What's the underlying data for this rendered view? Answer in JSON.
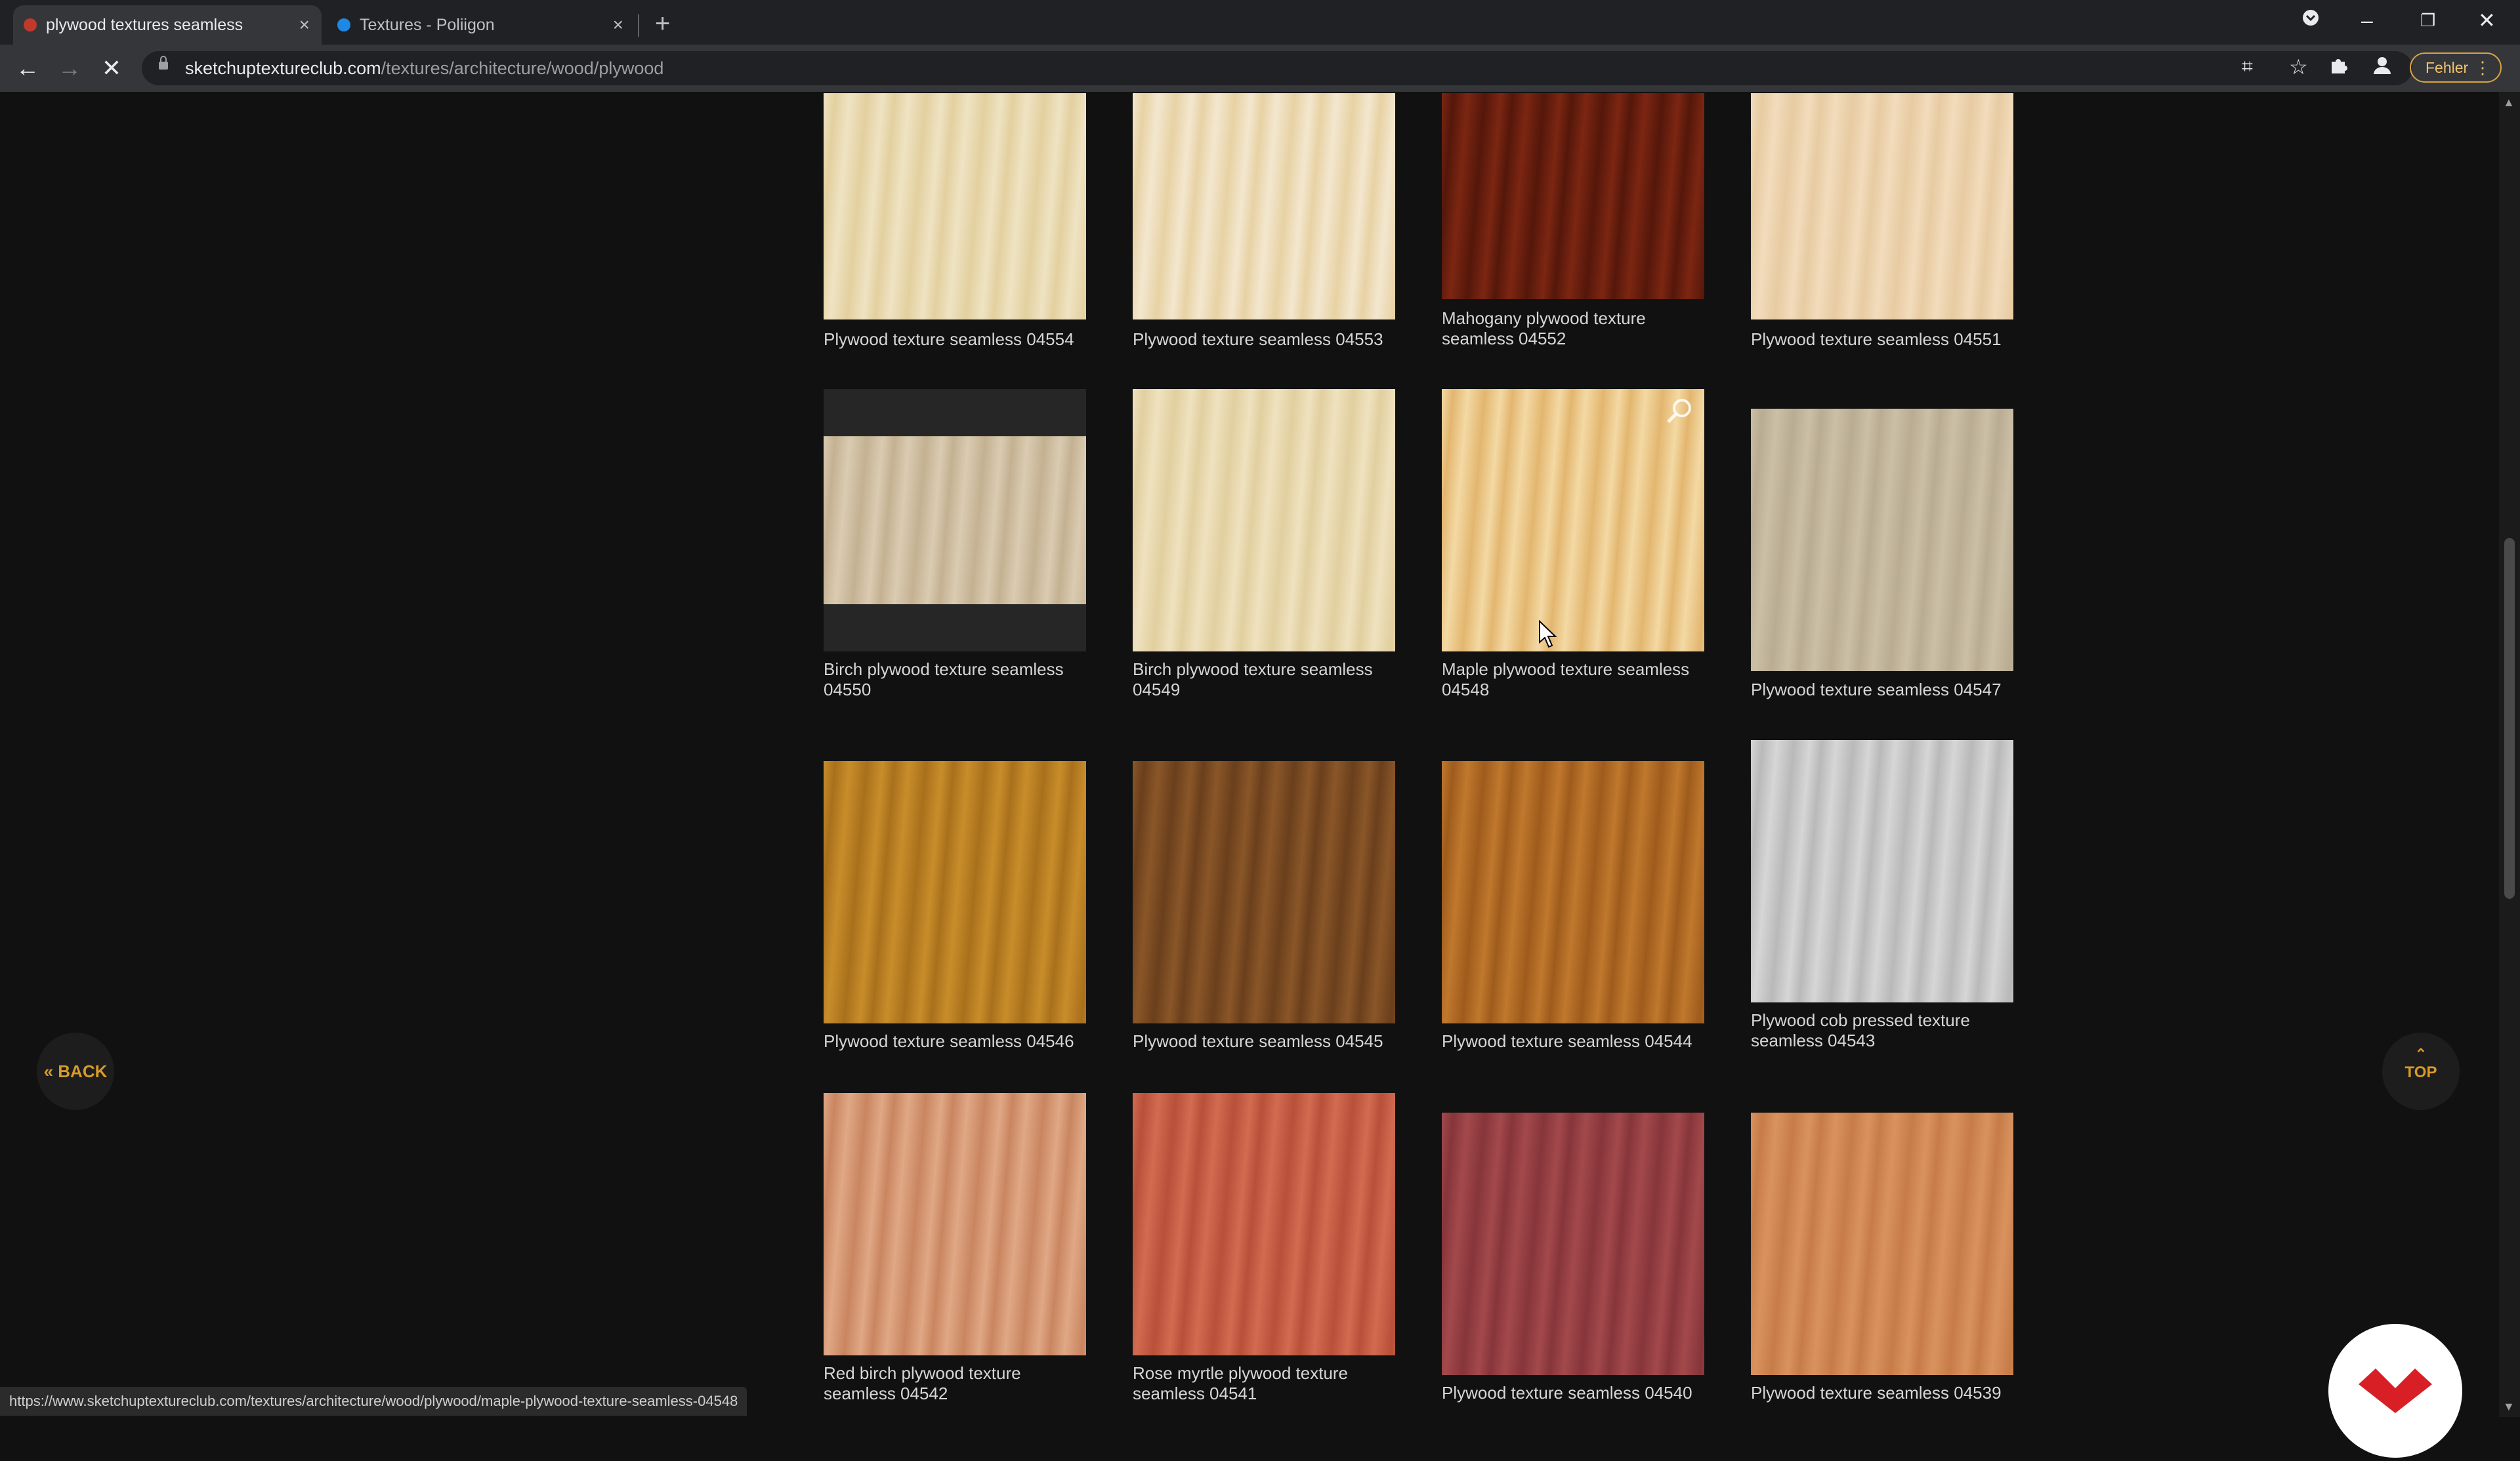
{
  "browser": {
    "tabs": [
      {
        "title": "plywood textures seamless",
        "active": true,
        "favicon_color": "#c0392b"
      },
      {
        "title": "Textures - Poliigon",
        "active": false,
        "favicon_color": "#1e88e5"
      }
    ],
    "new_tab_label": "+",
    "url_host": "sketchuptextureclub.com",
    "url_path": "/textures/architecture/wood/plywood",
    "profile_button_label": "Fehler",
    "status_url": "https://www.sketchuptextureclub.com/textures/architecture/wood/plywood/maple-plywood-texture-seamless-04548"
  },
  "page": {
    "back_label": "« BACK",
    "top_label": "TOP",
    "accent_color": "#d79a2a",
    "textures": [
      {
        "caption": "Plywood texture seamless 04554",
        "colors": [
          "#efe3c3",
          "#e3d09f"
        ]
      },
      {
        "caption": "Plywood texture seamless 04553",
        "colors": [
          "#f3e7cf",
          "#e8d2a4"
        ]
      },
      {
        "caption": "Mahogany plywood texture seamless 04552",
        "colors": [
          "#7c2612",
          "#54170a"
        ]
      },
      {
        "caption": "Plywood texture seamless 04551",
        "colors": [
          "#f2dcbc",
          "#e7cba2"
        ]
      },
      {
        "caption": "Birch plywood texture seamless 04550",
        "colors": [
          "#dacbb1",
          "#c4b192"
        ]
      },
      {
        "caption": "Birch plywood texture seamless 04549",
        "colors": [
          "#efe2bf",
          "#e1cf9f"
        ]
      },
      {
        "caption": "Maple plywood texture seamless 04548",
        "colors": [
          "#f3d9a4",
          "#e3b66f"
        ]
      },
      {
        "caption": "Plywood texture seamless 04547",
        "colors": [
          "#cbbfa6",
          "#b9ac92"
        ]
      },
      {
        "caption": "Plywood texture seamless 04546",
        "colors": [
          "#c88d2a",
          "#a9701c"
        ]
      },
      {
        "caption": "Plywood texture seamless 04545",
        "colors": [
          "#8a5628",
          "#6a3f1c"
        ]
      },
      {
        "caption": "Plywood texture seamless 04544",
        "colors": [
          "#c0782d",
          "#9e5b1c"
        ]
      },
      {
        "caption": "Plywood cob pressed texture seamless 04543",
        "colors": [
          "#d6d6d6",
          "#b9b9b9"
        ]
      },
      {
        "caption": "Red birch plywood texture seamless 04542",
        "colors": [
          "#e0a886",
          "#c98560"
        ]
      },
      {
        "caption": "Rose myrtle plywood texture seamless 04541",
        "colors": [
          "#d26b50",
          "#b8503a"
        ]
      },
      {
        "caption": "Plywood texture seamless 04540",
        "colors": [
          "#a3494c",
          "#86353a"
        ]
      },
      {
        "caption": "Plywood texture seamless 04539",
        "colors": [
          "#d9925e",
          "#c77c48"
        ]
      }
    ]
  }
}
